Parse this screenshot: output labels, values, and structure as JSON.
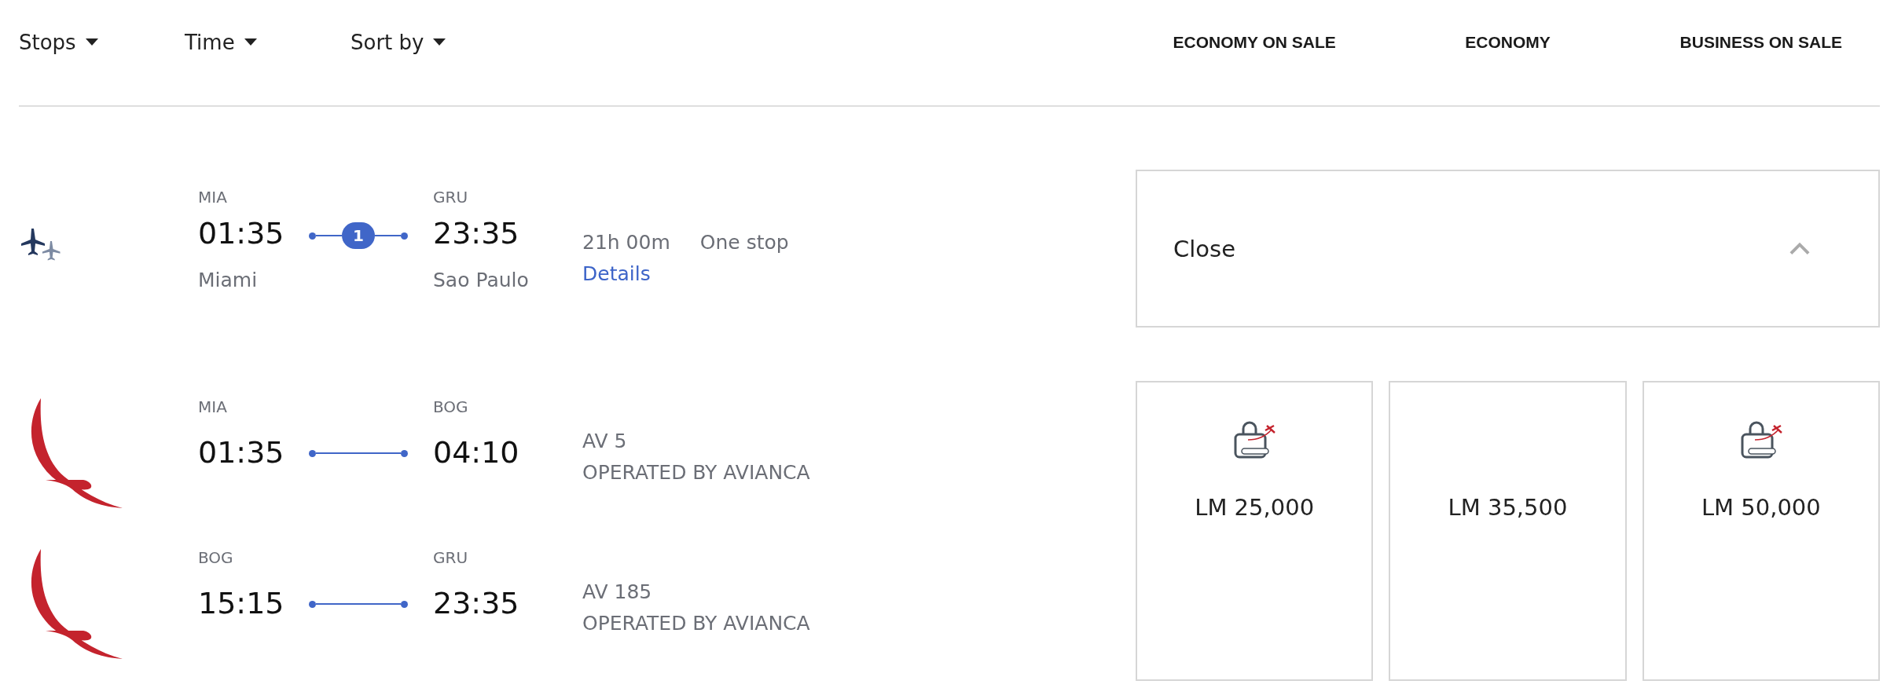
{
  "filters": [
    {
      "label": "Stops"
    },
    {
      "label": "Time"
    },
    {
      "label": "Sort by"
    }
  ],
  "fare_columns": [
    "ECONOMY ON SALE",
    "ECONOMY",
    "BUSINESS ON SALE"
  ],
  "itinerary": {
    "origin": {
      "code": "MIA",
      "time": "01:35",
      "city": "Miami"
    },
    "stops": "1",
    "destination": {
      "code": "GRU",
      "time": "23:35",
      "city": "Sao Paulo"
    },
    "duration": "21h 00m",
    "stops_label": "One stop",
    "details_link": "Details",
    "toggle": {
      "label": "Close",
      "expanded": true
    }
  },
  "segments": [
    {
      "from": {
        "code": "MIA",
        "time": "01:35"
      },
      "to": {
        "code": "BOG",
        "time": "04:10"
      },
      "flight": "AV 5",
      "operator": "OPERATED BY AVIANCA"
    },
    {
      "from": {
        "code": "BOG",
        "time": "15:15"
      },
      "to": {
        "code": "GRU",
        "time": "23:35"
      },
      "flight": "AV 185",
      "operator": "OPERATED BY AVIANCA"
    }
  ],
  "fares": [
    {
      "price": "LM 25,000",
      "locked": true
    },
    {
      "price": "LM 35,500",
      "locked": false
    },
    {
      "price": "LM 50,000",
      "locked": true
    }
  ]
}
